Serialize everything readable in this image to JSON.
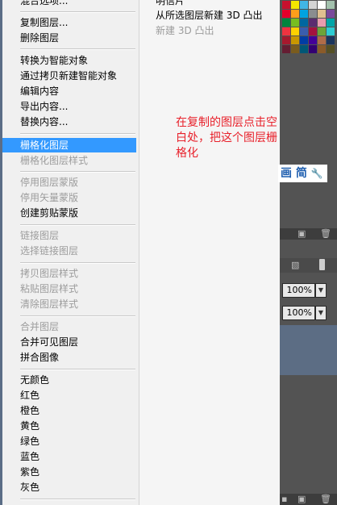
{
  "menu": {
    "top_partial": "混合选项...",
    "items": [
      {
        "label": "复制图层...",
        "state": "normal"
      },
      {
        "label": "删除图层",
        "state": "normal"
      },
      {
        "label": "转换为智能对象",
        "state": "normal"
      },
      {
        "label": "通过拷贝新建智能对象",
        "state": "normal"
      },
      {
        "label": "编辑内容",
        "state": "normal"
      },
      {
        "label": "导出内容...",
        "state": "normal"
      },
      {
        "label": "替换内容...",
        "state": "normal"
      },
      {
        "label": "栅格化图层",
        "state": "highlight"
      },
      {
        "label": "栅格化图层样式",
        "state": "disabled"
      },
      {
        "label": "停用图层蒙版",
        "state": "disabled"
      },
      {
        "label": "停用矢量蒙版",
        "state": "disabled"
      },
      {
        "label": "创建剪贴蒙版",
        "state": "normal"
      },
      {
        "label": "链接图层",
        "state": "disabled"
      },
      {
        "label": "选择链接图层",
        "state": "disabled"
      },
      {
        "label": "拷贝图层样式",
        "state": "disabled"
      },
      {
        "label": "粘贴图层样式",
        "state": "disabled"
      },
      {
        "label": "清除图层样式",
        "state": "disabled"
      },
      {
        "label": "合并图层",
        "state": "disabled"
      },
      {
        "label": "合并可见图层",
        "state": "normal"
      },
      {
        "label": "拼合图像",
        "state": "normal"
      },
      {
        "label": "无颜色",
        "state": "normal"
      },
      {
        "label": "红色",
        "state": "normal"
      },
      {
        "label": "橙色",
        "state": "normal"
      },
      {
        "label": "黄色",
        "state": "normal"
      },
      {
        "label": "绿色",
        "state": "normal"
      },
      {
        "label": "蓝色",
        "state": "normal"
      },
      {
        "label": "紫色",
        "state": "normal"
      },
      {
        "label": "灰色",
        "state": "normal"
      }
    ]
  },
  "submenu": {
    "items": [
      {
        "label": "明信片",
        "state": "normal"
      },
      {
        "label": "从所选图层新建 3D 凸出",
        "state": "normal"
      },
      {
        "label": "新建 3D 凸出",
        "state": "disabled"
      }
    ]
  },
  "annotation": "在复制的图层点击空白处，把这个图层栅格化",
  "chip_text": "画 简",
  "panel": {
    "opacity_value": "100%",
    "fill_value": "100%"
  },
  "colors": {
    "highlight": "#3399ff",
    "annotation": "#e8212b",
    "panel_bg": "#535353"
  }
}
